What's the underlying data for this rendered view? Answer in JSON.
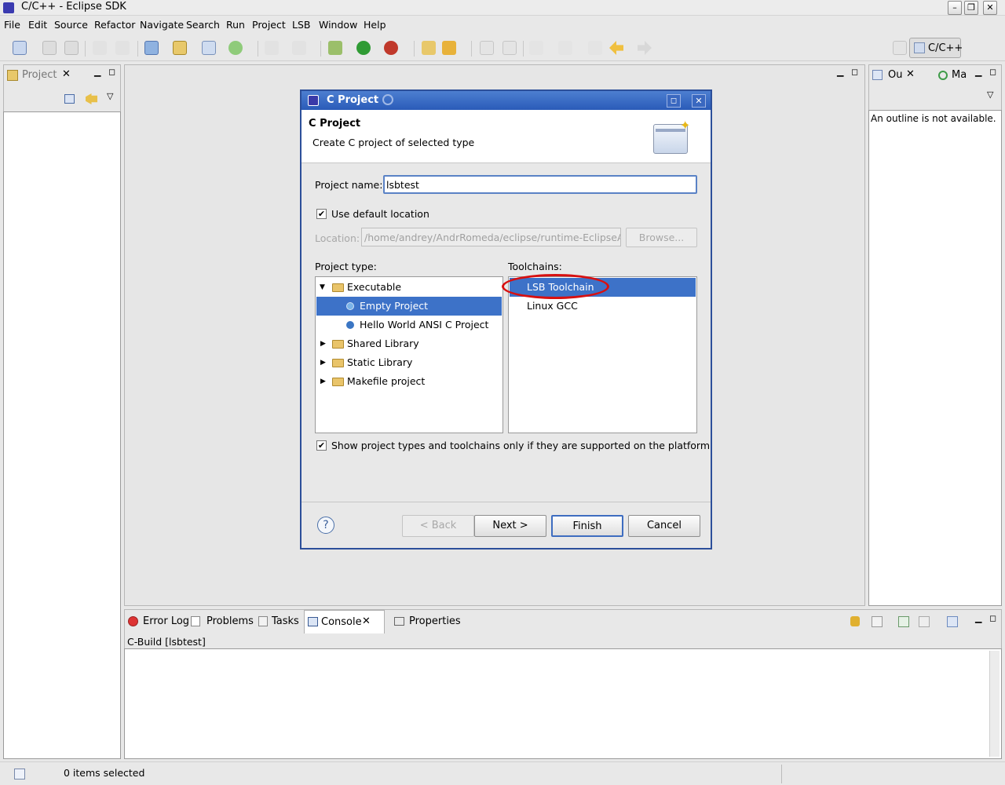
{
  "window": {
    "title": "C/C++ - Eclipse SDK"
  },
  "menu": [
    "File",
    "Edit",
    "Source",
    "Refactor",
    "Navigate",
    "Search",
    "Run",
    "Project",
    "LSB",
    "Window",
    "Help"
  ],
  "perspective": {
    "label": "C/C++"
  },
  "left_view": {
    "tab": "Project"
  },
  "right_view": {
    "tab1": "Ou",
    "tab2": "Ma",
    "message": "An outline is not available."
  },
  "bottom_view": {
    "tabs": [
      "Error Log",
      "Problems",
      "Tasks",
      "Console",
      "Properties"
    ],
    "console_title": "C-Build [lsbtest]"
  },
  "status": {
    "text": "0 items selected"
  },
  "dialog": {
    "title": "C Project",
    "header_title": "C Project",
    "header_desc": "Create C project of selected type",
    "project_name_label": "Project name:",
    "project_name_value": "lsbtest",
    "use_default_label": "Use default location",
    "location_label": "Location:",
    "location_value": "/home/andrey/AndrRomeda/eclipse/runtime-EclipseAppli",
    "browse_label": "Browse...",
    "project_type_label": "Project type:",
    "toolchains_label": "Toolchains:",
    "project_types": [
      "Executable",
      "Empty Project",
      "Hello World ANSI C Project",
      "Shared Library",
      "Static Library",
      "Makefile project"
    ],
    "toolchains": [
      "LSB Toolchain",
      "Linux GCC"
    ],
    "show_supported_label": "Show project types and toolchains only if they are supported on the platform",
    "back_label": "< Back",
    "next_label": "Next >",
    "finish_label": "Finish",
    "cancel_label": "Cancel"
  },
  "colors": {
    "selection": "#3d72c8",
    "highlight_ring": "#d81010",
    "dialog_title": "#2a5bb8"
  }
}
